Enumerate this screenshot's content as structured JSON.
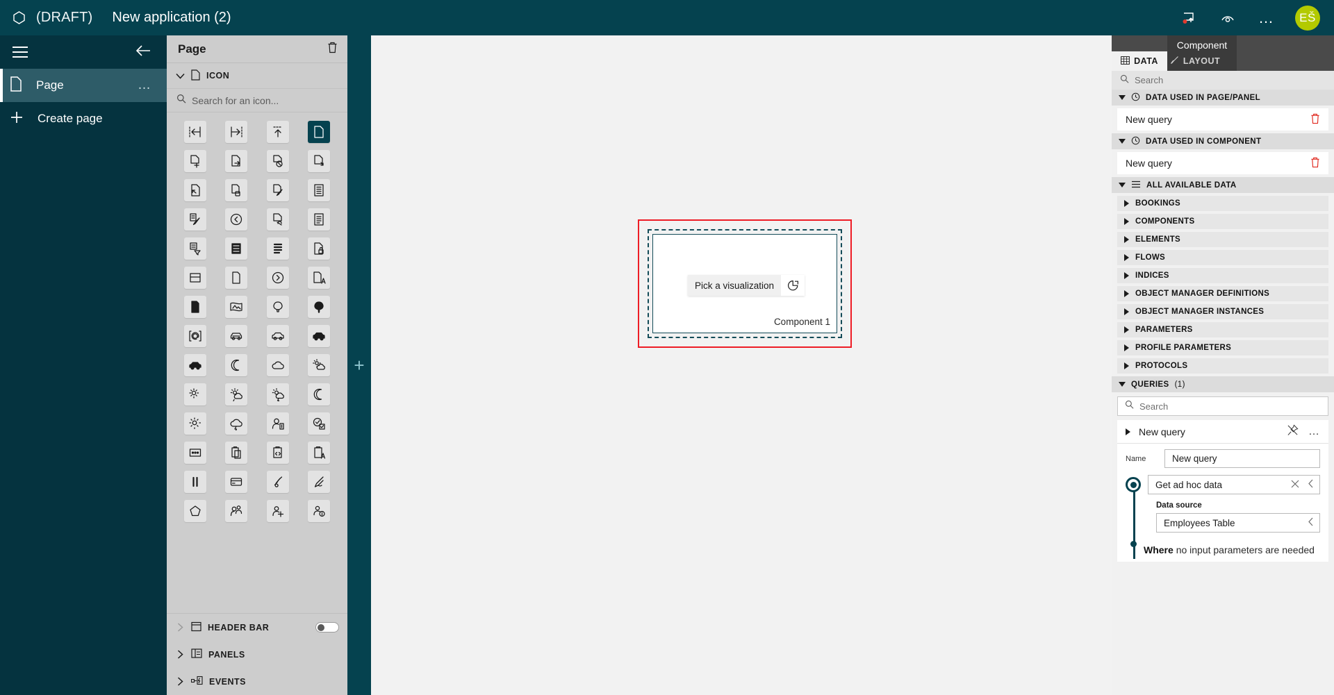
{
  "topbar": {
    "brand_icon": "hexagon-outline-icon",
    "draft_label": "(DRAFT)",
    "app_title": "New application (2)",
    "actions": [
      {
        "name": "notifications-icon",
        "label": ""
      },
      {
        "name": "preview-eye-icon",
        "label": ""
      },
      {
        "name": "more-options-icon",
        "label": "…"
      }
    ],
    "avatar_initials": "EŠ",
    "avatar_color": "#b3ca00",
    "background": "#05424f"
  },
  "leftnav": {
    "menu_icon": "hamburger-icon",
    "collapse_icon": "back-arrow-icon",
    "items": [
      {
        "label": "Page",
        "icon": "document-icon",
        "active": true,
        "overflow": "…"
      },
      {
        "label": "Create page",
        "icon": "plus-icon",
        "active": false
      }
    ]
  },
  "pagepanel": {
    "title": "Page",
    "delete_icon": "trash-icon",
    "icon_section": {
      "label": "ICON",
      "icon": "document-icon",
      "expanded": true
    },
    "icon_search": {
      "placeholder": "Search for an icon...",
      "value": "",
      "icon": "search-icon"
    },
    "selected_icon_index": 3,
    "icons": [
      "align-left-icon",
      "align-right-icon",
      "align-top-icon",
      "document-icon",
      "document-add-icon",
      "document-forward-icon",
      "document-block-icon",
      "document-down-icon",
      "document-back-icon",
      "document-copy-icon",
      "document-edit-icon",
      "document-list-icon",
      "document-note-edit-icon",
      "clock-back-icon",
      "document-link-icon",
      "document-lines-icon",
      "document-filter-icon",
      "document-bars-solid-icon",
      "document-bars-bold-icon",
      "document-lock-icon",
      "document-header-icon",
      "document-blank-icon",
      "clock-forward-icon",
      "document-a-icon",
      "document-solid-icon",
      "panorama-icon",
      "balloon-icon",
      "balloon-solid-icon",
      "at-bracket-icon",
      "car-outline-icon",
      "car-side-icon",
      "car-solid-icon",
      "car-filled-icon",
      "moon-icon",
      "cloud-icon",
      "cloud-sun-icon",
      "sun-cloud-icon",
      "sun-rain-icon",
      "sun-storm-icon",
      "moon-cloud-icon",
      "sun-bright-icon",
      "cloud-lightning-icon",
      "user-badge-icon",
      "shield-check-icon",
      "ellipsis-box-icon",
      "clipboard-icon",
      "clipboard-code-icon",
      "clipboard-a-icon",
      "pause-icon",
      "card-icon",
      "paint-brush-icon",
      "pen-icon",
      "pentagon-icon",
      "people-icon",
      "person-add-icon",
      "person-info-icon"
    ],
    "sections": [
      {
        "label": "HEADER BAR",
        "icon": "header-bar-icon",
        "expanded": false,
        "has_toggle": true,
        "toggle_on": false
      },
      {
        "label": "PANELS",
        "icon": "panels-icon",
        "expanded": false,
        "has_toggle": false
      },
      {
        "label": "EVENTS",
        "icon": "events-icon",
        "expanded": false,
        "has_toggle": false
      }
    ]
  },
  "canvas": {
    "add_handle": "+",
    "component": {
      "pick_label": "Pick a visualization",
      "pick_icon": "pie-chart-icon",
      "name_label": "Component 1",
      "selection_color": "#ee1c25"
    }
  },
  "rightpanel": {
    "badge_label": "Component",
    "tabs": [
      {
        "label": "DATA",
        "icon": "table-icon",
        "active": true
      },
      {
        "label": "LAYOUT",
        "icon": "brush-icon",
        "active": false
      }
    ],
    "search": {
      "placeholder": "Search",
      "value": "",
      "icon": "search-icon"
    },
    "sections": [
      {
        "label": "DATA USED IN PAGE/PANEL",
        "icon": "history-clock-icon",
        "expanded": true,
        "rows": [
          {
            "label": "New query",
            "delete_icon": "trash-icon"
          }
        ]
      },
      {
        "label": "DATA USED IN COMPONENT",
        "icon": "history-clock-icon",
        "expanded": true,
        "rows": [
          {
            "label": "New query",
            "delete_icon": "trash-icon"
          }
        ]
      }
    ],
    "all_available_data": {
      "label": "ALL AVAILABLE DATA",
      "icon": "list-icon",
      "expanded": true,
      "categories": [
        "BOOKINGS",
        "COMPONENTS",
        "ELEMENTS",
        "FLOWS",
        "INDICES",
        "OBJECT MANAGER DEFINITIONS",
        "OBJECT MANAGER INSTANCES",
        "PARAMETERS",
        "PROFILE PARAMETERS",
        "PROTOCOLS"
      ]
    },
    "queries": {
      "label": "QUERIES",
      "count": "(1)",
      "expanded": true,
      "search": {
        "placeholder": "Search",
        "value": "",
        "icon": "search-icon"
      },
      "item": {
        "title": "New query",
        "edit_icon": "unpin-icon",
        "more_icon": "…",
        "name_label": "Name",
        "name_value": "New query",
        "action_value": "Get ad hoc data",
        "action_clear_icon": "close-icon",
        "action_expand_icon": "chevron-left-icon",
        "data_source_label": "Data source",
        "data_source_value": "Employees Table",
        "data_source_expand_icon": "chevron-left-icon",
        "where_prefix": "Where",
        "where_text": "no input parameters are needed"
      }
    }
  }
}
